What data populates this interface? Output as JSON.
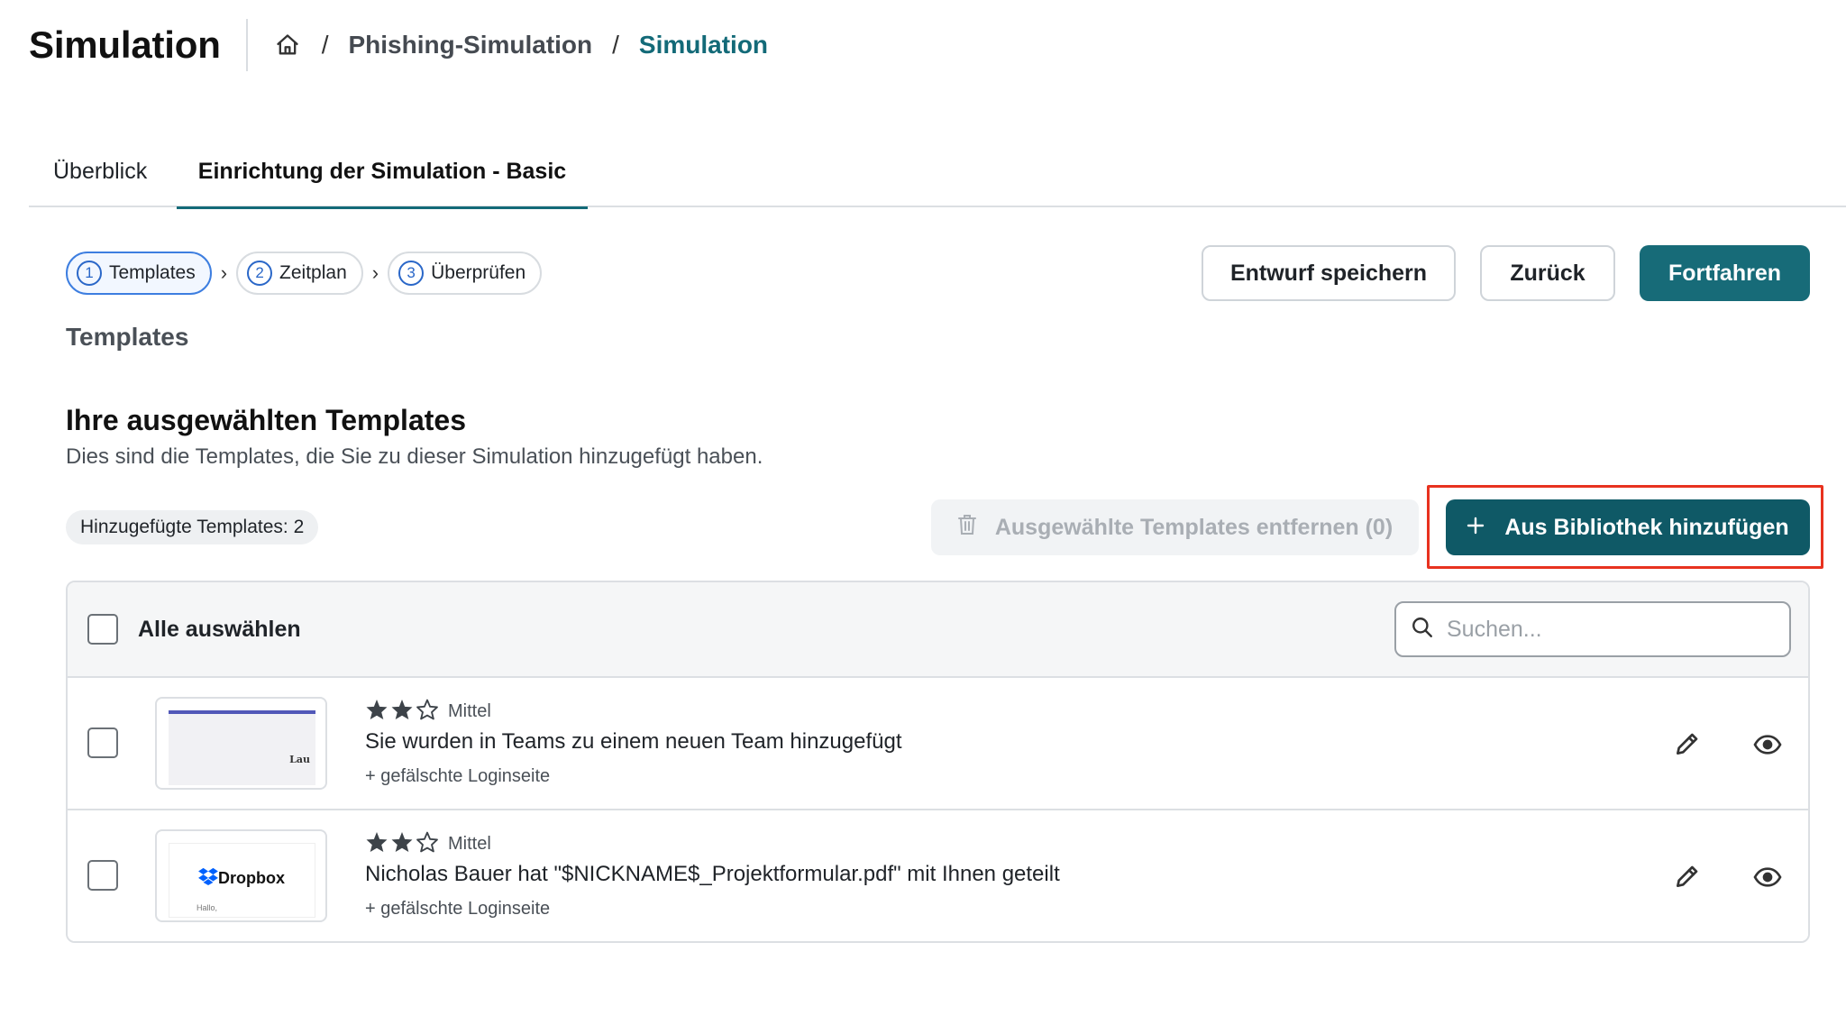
{
  "header": {
    "title": "Simulation",
    "breadcrumb": [
      "Phishing-Simulation",
      "Simulation"
    ],
    "separator": "/"
  },
  "tabs": [
    {
      "label": "Überblick",
      "active": false
    },
    {
      "label": "Einrichtung der Simulation - Basic",
      "active": true
    }
  ],
  "stepper": [
    {
      "num": "1",
      "label": "Templates",
      "active": true
    },
    {
      "num": "2",
      "label": "Zeitplan",
      "active": false
    },
    {
      "num": "3",
      "label": "Überprüfen",
      "active": false
    }
  ],
  "actions": {
    "save_label": "Entwurf speichern",
    "back_label": "Zurück",
    "next_label": "Fortfahren"
  },
  "section_label": "Templates",
  "selected": {
    "title": "Ihre ausgewählten Templates",
    "description": "Dies sind die Templates, die Sie zu dieser Simulation hinzugefügt haben.",
    "count_label": "Hinzugefügte Templates: 2",
    "remove_label": "Ausgewählte Templates entfernen (0)",
    "add_label": "Aus Bibliothek hinzufügen"
  },
  "table": {
    "select_all_label": "Alle auswählen",
    "search_placeholder": "Suchen...",
    "rows": [
      {
        "rating": 2,
        "rating_max": 3,
        "level": "Mittel",
        "title": "Sie wurden in Teams zu einem neuen Team hinzugefügt",
        "subtitle": "+ gefälschte Loginseite",
        "thumb_text": "Lau"
      },
      {
        "rating": 2,
        "rating_max": 3,
        "level": "Mittel",
        "title": "Nicholas Bauer hat \"$NICKNAME$_Projektformular.pdf\" mit Ihnen geteilt",
        "subtitle": "+ gefälschte Loginseite",
        "thumb_brand": "Dropbox",
        "thumb_greeting": "Hallo,"
      }
    ]
  },
  "colors": {
    "primary": "#176b78",
    "primary_dark": "#0f5966",
    "breadcrumb_current": "#136a78",
    "highlight": "#e8321f",
    "step_active": "#2a67c8"
  },
  "icons": [
    "home-icon",
    "chevron-right-icon",
    "trash-icon",
    "plus-icon",
    "search-icon",
    "star-icon",
    "pencil-icon",
    "eye-icon",
    "dropbox-icon"
  ]
}
